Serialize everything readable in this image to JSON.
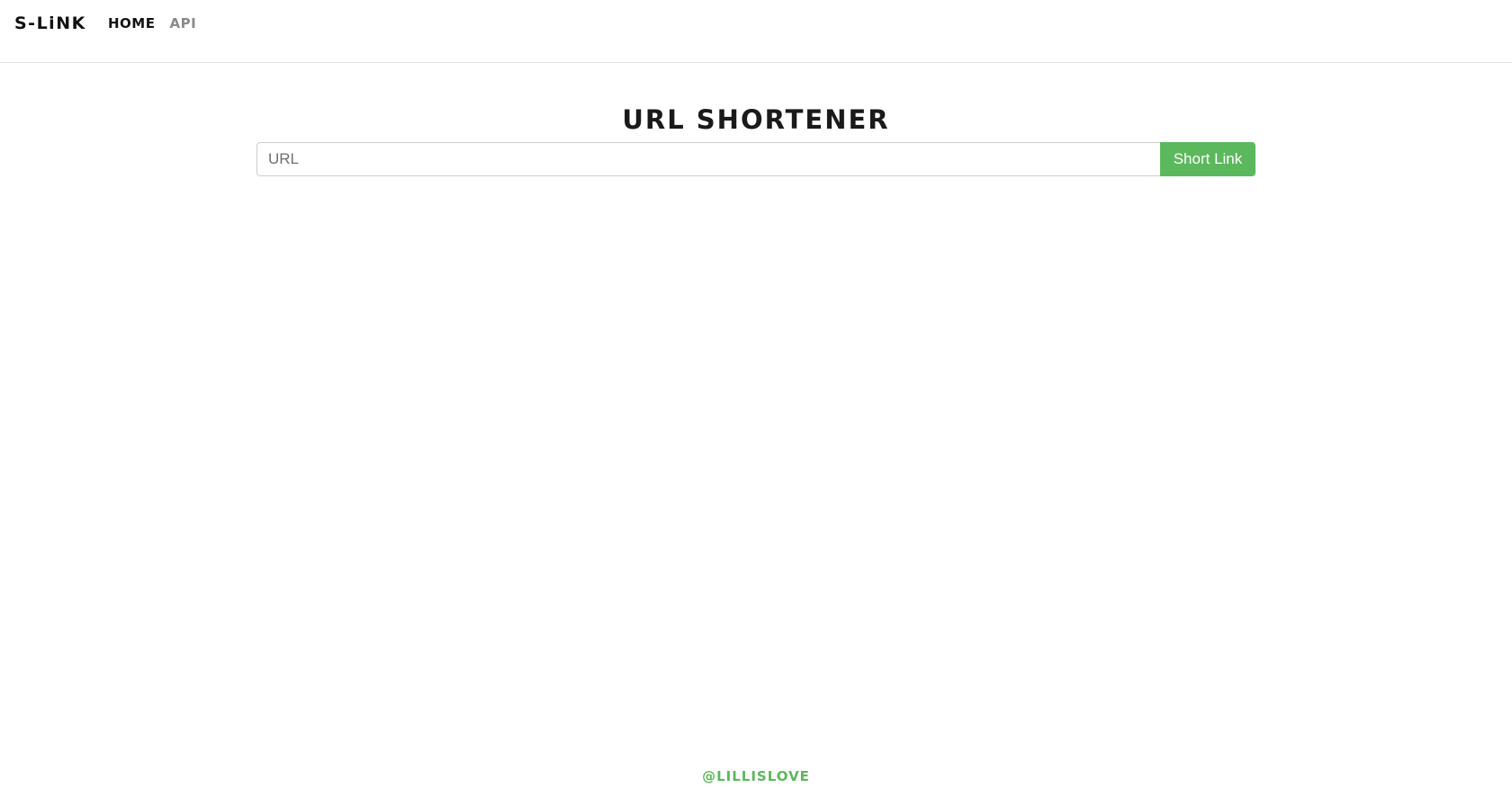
{
  "brand": {
    "name": "S-LiNK"
  },
  "nav": {
    "items": [
      {
        "label": "HOME",
        "state": "active"
      },
      {
        "label": "API",
        "state": "inactive"
      }
    ]
  },
  "main": {
    "title": "URL SHORTENER",
    "url_input": {
      "placeholder": "URL",
      "value": ""
    },
    "submit_label": "Short Link"
  },
  "footer": {
    "credit": "@LILLISLOVE"
  },
  "colors": {
    "accent": "#5cb85c",
    "text": "#111111",
    "muted_nav": "#8a8a8a",
    "border": "#e3e3e3"
  }
}
